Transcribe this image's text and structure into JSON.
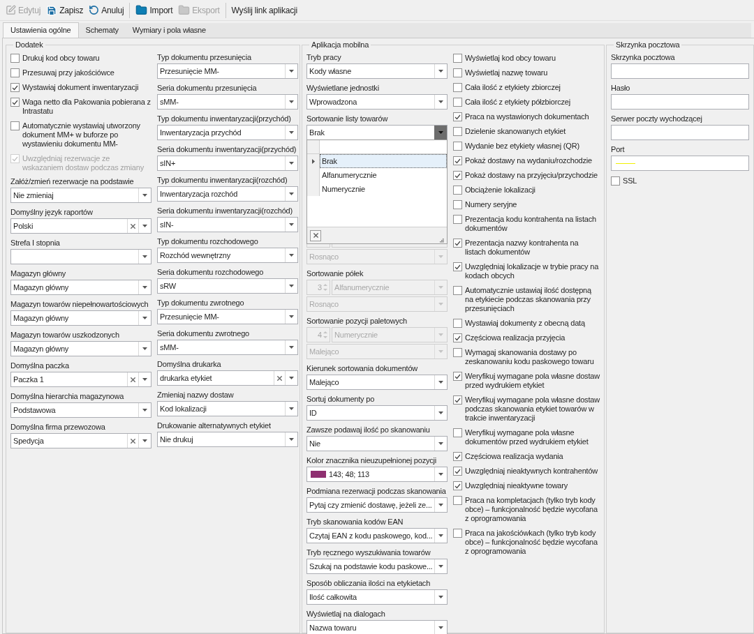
{
  "toolbar": [
    [
      {
        "label": "Edytuj",
        "disabled": true
      },
      {
        "label": "Zapisz",
        "disabled": false
      },
      {
        "label": "Anuluj",
        "disabled": false
      }
    ],
    [
      {
        "label": "Import",
        "disabled": false
      },
      {
        "label": "Eksport",
        "disabled": true
      }
    ],
    [
      {
        "label": "Wyślij link aplikacji",
        "disabled": false
      }
    ]
  ],
  "tabs": [
    {
      "label": "Ustawienia ogólne",
      "selected": true
    },
    {
      "label": "Schematy",
      "selected": false
    },
    {
      "label": "Wymiary i pola własne",
      "selected": false
    }
  ],
  "panels": [
    {
      "title": "Dodatek",
      "columns": [
        [
          {
            "kind": "checkbox",
            "label": "Drukuj kod obcy towaru",
            "checked": false,
            "disabled": false
          },
          {
            "kind": "checkbox",
            "label": "Przesuwaj przy jakościówce",
            "checked": false,
            "disabled": false
          },
          {
            "kind": "checkbox",
            "label": "Wystawiaj dokument inwentaryzacji",
            "checked": true,
            "disabled": false
          },
          {
            "kind": "checkbox",
            "label": "Waga netto dla Pakowania pobierana z Intrastatu",
            "checked": true,
            "disabled": false
          },
          {
            "kind": "checkbox",
            "label": "Automatycznie wystawiaj utworzony dokument MM+ w buforze po wystawieniu dokumentu MM-",
            "checked": false,
            "disabled": false
          },
          {
            "kind": "checkbox",
            "label": "Uwzględniaj rezerwacje ze wskazaniem dostaw podczas zmiany",
            "checked": true,
            "disabled": true
          },
          {
            "kind": "combo",
            "label": "Załóż/zmień rezerwacje na podstawie",
            "value": "Nie zmieniaj",
            "clearable": false
          },
          {
            "kind": "combo",
            "label": "Domyślny język raportów",
            "value": "Polski",
            "clearable": true
          },
          {
            "kind": "combo",
            "label": "Strefa I stopnia",
            "clearable": false
          },
          {
            "kind": "combo",
            "label": "Magazyn główny",
            "value": "Magazyn główny",
            "clearable": false
          },
          {
            "kind": "combo",
            "label": "Magazyn towarów niepełnowartościowych",
            "value": "Magazyn główny",
            "clearable": false
          },
          {
            "kind": "combo",
            "label": "Magazyn towarów uszkodzonych",
            "value": "Magazyn główny",
            "clearable": false
          },
          {
            "kind": "combo",
            "label": "Domyślna paczka",
            "value": "Paczka 1",
            "clearable": true
          },
          {
            "kind": "combo",
            "label": "Domyślna hierarchia magazynowa",
            "value": "Podstawowa",
            "clearable": false
          },
          {
            "kind": "combo",
            "label": "Domyślna firma przewozowa",
            "value": "Spedycja",
            "clearable": true
          }
        ],
        [
          {
            "kind": "combo",
            "label": "Typ dokumentu przesunięcia",
            "value": "Przesunięcie MM-",
            "clearable": false
          },
          {
            "kind": "combo",
            "label": "Seria dokumentu przesunięcia",
            "value": "sMM-",
            "clearable": false
          },
          {
            "kind": "combo",
            "label": "Typ dokumentu inwentaryzacji(przychód)",
            "value": "Inwentaryzacja przychód",
            "clearable": false
          },
          {
            "kind": "combo",
            "label": "Seria dokumentu inwentaryzacji(przychód)",
            "value": "sIN+",
            "clearable": false
          },
          {
            "kind": "combo",
            "label": "Typ dokumentu inwentaryzacji(rozchód)",
            "value": "Inwentaryzacja rozchód",
            "clearable": false
          },
          {
            "kind": "combo",
            "label": "Seria dokumentu inwentaryzacji(rozchód)",
            "value": "sIN-",
            "clearable": false
          },
          {
            "kind": "combo",
            "label": "Typ dokumentu rozchodowego",
            "value": "Rozchód wewnętrzny",
            "clearable": false
          },
          {
            "kind": "combo",
            "label": "Seria dokumentu rozchodowego",
            "value": "sRW",
            "clearable": false
          },
          {
            "kind": "combo",
            "label": "Typ dokumentu zwrotnego",
            "value": "Przesunięcie MM-",
            "clearable": false
          },
          {
            "kind": "combo",
            "label": "Seria dokumentu zwrotnego",
            "value": "sMM-",
            "clearable": false
          },
          {
            "kind": "combo",
            "label": "Domyślna drukarka",
            "value": "drukarka etykiet",
            "clearable": true
          },
          {
            "kind": "combo",
            "label": "Zmieniaj nazwy dostaw",
            "value": "Kod lokalizacji",
            "clearable": false
          },
          {
            "kind": "combo",
            "label": "Drukowanie alternatywnych etykiet",
            "value": "Nie drukuj",
            "clearable": false
          }
        ]
      ]
    },
    {
      "title": "Aplikacja mobilna",
      "columns": [
        [
          {
            "kind": "combo",
            "label": "Tryb pracy",
            "value": "Kody własne",
            "clearable": false
          },
          {
            "kind": "combo",
            "label": "Wyświetlane jednostki",
            "value": "Wprowadzona",
            "clearable": false
          },
          {
            "kind": "sort",
            "label": "Sortowanie listy towarów",
            "value": "Brak",
            "open": true,
            "options": [
              {
                "label": "Brak",
                "selected": true
              },
              {
                "label": "Alfanumerycznie",
                "selected": false
              },
              {
                "label": "Numerycznie",
                "selected": false
              }
            ],
            "direction": "Rosnąco",
            "disabled": true
          },
          {
            "kind": "sort",
            "label": "Sortowanie półek",
            "number": "3",
            "order": "Alfanumerycznie",
            "direction": "Rosnąco",
            "disabled": true
          },
          {
            "kind": "sort",
            "label": "Sortowanie pozycji paletowych",
            "number": "4",
            "order": "Numerycznie",
            "direction": "Malejąco",
            "disabled": true
          },
          {
            "kind": "combo",
            "label": "Kierunek sortowania dokumentów",
            "value": "Malejąco",
            "clearable": false
          },
          {
            "kind": "combo",
            "label": "Sortuj dokumenty po",
            "value": "ID",
            "clearable": false
          },
          {
            "kind": "combo",
            "label": "Zawsze podawaj ilość po skanowaniu",
            "value": "Nie",
            "clearable": false
          },
          {
            "kind": "color",
            "label": "Kolor znacznika nieuzupełnionej pozycji",
            "value": "143; 48; 113",
            "color": "#8f3071"
          },
          {
            "kind": "combo",
            "label": "Podmiana rezerwacji podczas skanowania",
            "value": "Pytaj czy zmienić dostawę, jeżeli ze...",
            "clearable": false
          },
          {
            "kind": "combo",
            "label": "Tryb skanowania kodów EAN",
            "value": "Czytaj EAN z kodu paskowego, kod...",
            "clearable": false
          },
          {
            "kind": "combo",
            "label": "Tryb ręcznego wyszukiwania towarów",
            "value": "Szukaj na podstawie kodu paskowe...",
            "clearable": false
          },
          {
            "kind": "combo",
            "label": "Sposób obliczania ilości na etykietach",
            "value": "Ilość całkowita",
            "clearable": false
          },
          {
            "kind": "combo",
            "label": "Wyświetlaj na dialogach",
            "value": "Nazwa towaru",
            "clearable": false
          }
        ],
        [
          {
            "kind": "checkbox",
            "label": "Wyświetlaj kod obcy towaru",
            "checked": false,
            "disabled": false
          },
          {
            "kind": "checkbox",
            "label": "Wyświetlaj nazwę towaru",
            "checked": false,
            "disabled": false
          },
          {
            "kind": "checkbox",
            "label": "Cała ilość z etykiety zbiorczej",
            "checked": false,
            "disabled": false
          },
          {
            "kind": "checkbox",
            "label": "Cała ilość z etykiety półzbiorczej",
            "checked": false,
            "disabled": false
          },
          {
            "kind": "checkbox",
            "label": "Praca na wystawionych dokumentach",
            "checked": true,
            "disabled": false
          },
          {
            "kind": "checkbox",
            "label": "Dzielenie skanowanych etykiet",
            "checked": false,
            "disabled": false
          },
          {
            "kind": "checkbox",
            "label": "Wydanie bez etykiety własnej (QR)",
            "checked": false,
            "disabled": false
          },
          {
            "kind": "checkbox",
            "label": "Pokaż dostawy na wydaniu/rozchodzie",
            "checked": true,
            "disabled": false
          },
          {
            "kind": "checkbox",
            "label": "Pokaż dostawy na przyjęciu/przychodzie",
            "checked": true,
            "disabled": false
          },
          {
            "kind": "checkbox",
            "label": "Obciążenie lokalizacji",
            "checked": false,
            "disabled": false
          },
          {
            "kind": "checkbox",
            "label": "Numery seryjne",
            "checked": false,
            "disabled": false
          },
          {
            "kind": "checkbox",
            "label": "Prezentacja kodu kontrahenta na listach dokumentów",
            "checked": false,
            "disabled": false
          },
          {
            "kind": "checkbox",
            "label": "Prezentacja nazwy kontrahenta na listach dokumentów",
            "checked": true,
            "disabled": false
          },
          {
            "kind": "checkbox",
            "label": "Uwzględniaj lokalizacje w trybie pracy na kodach obcych",
            "checked": true,
            "disabled": false
          },
          {
            "kind": "checkbox",
            "label": "Automatycznie ustawiaj ilość dostępną na etykiecie podczas skanowania przy przesunięciach",
            "checked": false,
            "disabled": false
          },
          {
            "kind": "checkbox",
            "label": "Wystawiaj dokumenty z obecną datą",
            "checked": false,
            "disabled": false
          },
          {
            "kind": "checkbox",
            "label": "Częściowa realizacja przyjęcia",
            "checked": true,
            "disabled": false
          },
          {
            "kind": "checkbox",
            "label": "Wymagaj skanowania dostawy po zeskanowaniu kodu paskowego towaru",
            "checked": false,
            "disabled": false
          },
          {
            "kind": "checkbox",
            "label": "Weryfikuj wymagane pola własne dostaw przed wydrukiem etykiet",
            "checked": true,
            "disabled": false
          },
          {
            "kind": "checkbox",
            "label": "Weryfikuj wymagane pola własne dostaw podczas skanowania etykiet towarów w trakcie inwentaryzacji",
            "checked": true,
            "disabled": false
          },
          {
            "kind": "checkbox",
            "label": "Weryfikuj wymagane pola własne dokumentów przed wydrukiem etykiet",
            "checked": false,
            "disabled": false
          },
          {
            "kind": "checkbox",
            "label": "Częściowa realizacja wydania",
            "checked": true,
            "disabled": false
          },
          {
            "kind": "checkbox",
            "label": "Uwzględniaj nieaktywnych kontrahentów",
            "checked": true,
            "disabled": false
          },
          {
            "kind": "checkbox",
            "label": "Uwzględniaj nieaktywne towary",
            "checked": true,
            "disabled": false
          },
          {
            "kind": "checkbox",
            "label": "Praca na kompletacjach (tylko tryb kody obce) – funkcjonalność będzie wycofana z oprogramowania",
            "checked": false,
            "disabled": false
          },
          {
            "kind": "checkbox",
            "label": "Praca na jakościówkach (tylko tryb kody obce) – funkcjonalność będzie wycofana z oprogramowania",
            "checked": false,
            "disabled": false
          }
        ]
      ]
    },
    {
      "title": "Skrzynka pocztowa",
      "columns": [
        [
          {
            "kind": "text",
            "label": "Skrzynka pocztowa"
          },
          {
            "kind": "text",
            "label": "Hasło"
          },
          {
            "kind": "text",
            "label": "Serwer poczty wychodzącej"
          },
          {
            "kind": "text",
            "label": "Port",
            "underline": true
          },
          {
            "kind": "checkbox",
            "label": "SSL",
            "checked": false,
            "disabled": false
          }
        ]
      ]
    }
  ]
}
